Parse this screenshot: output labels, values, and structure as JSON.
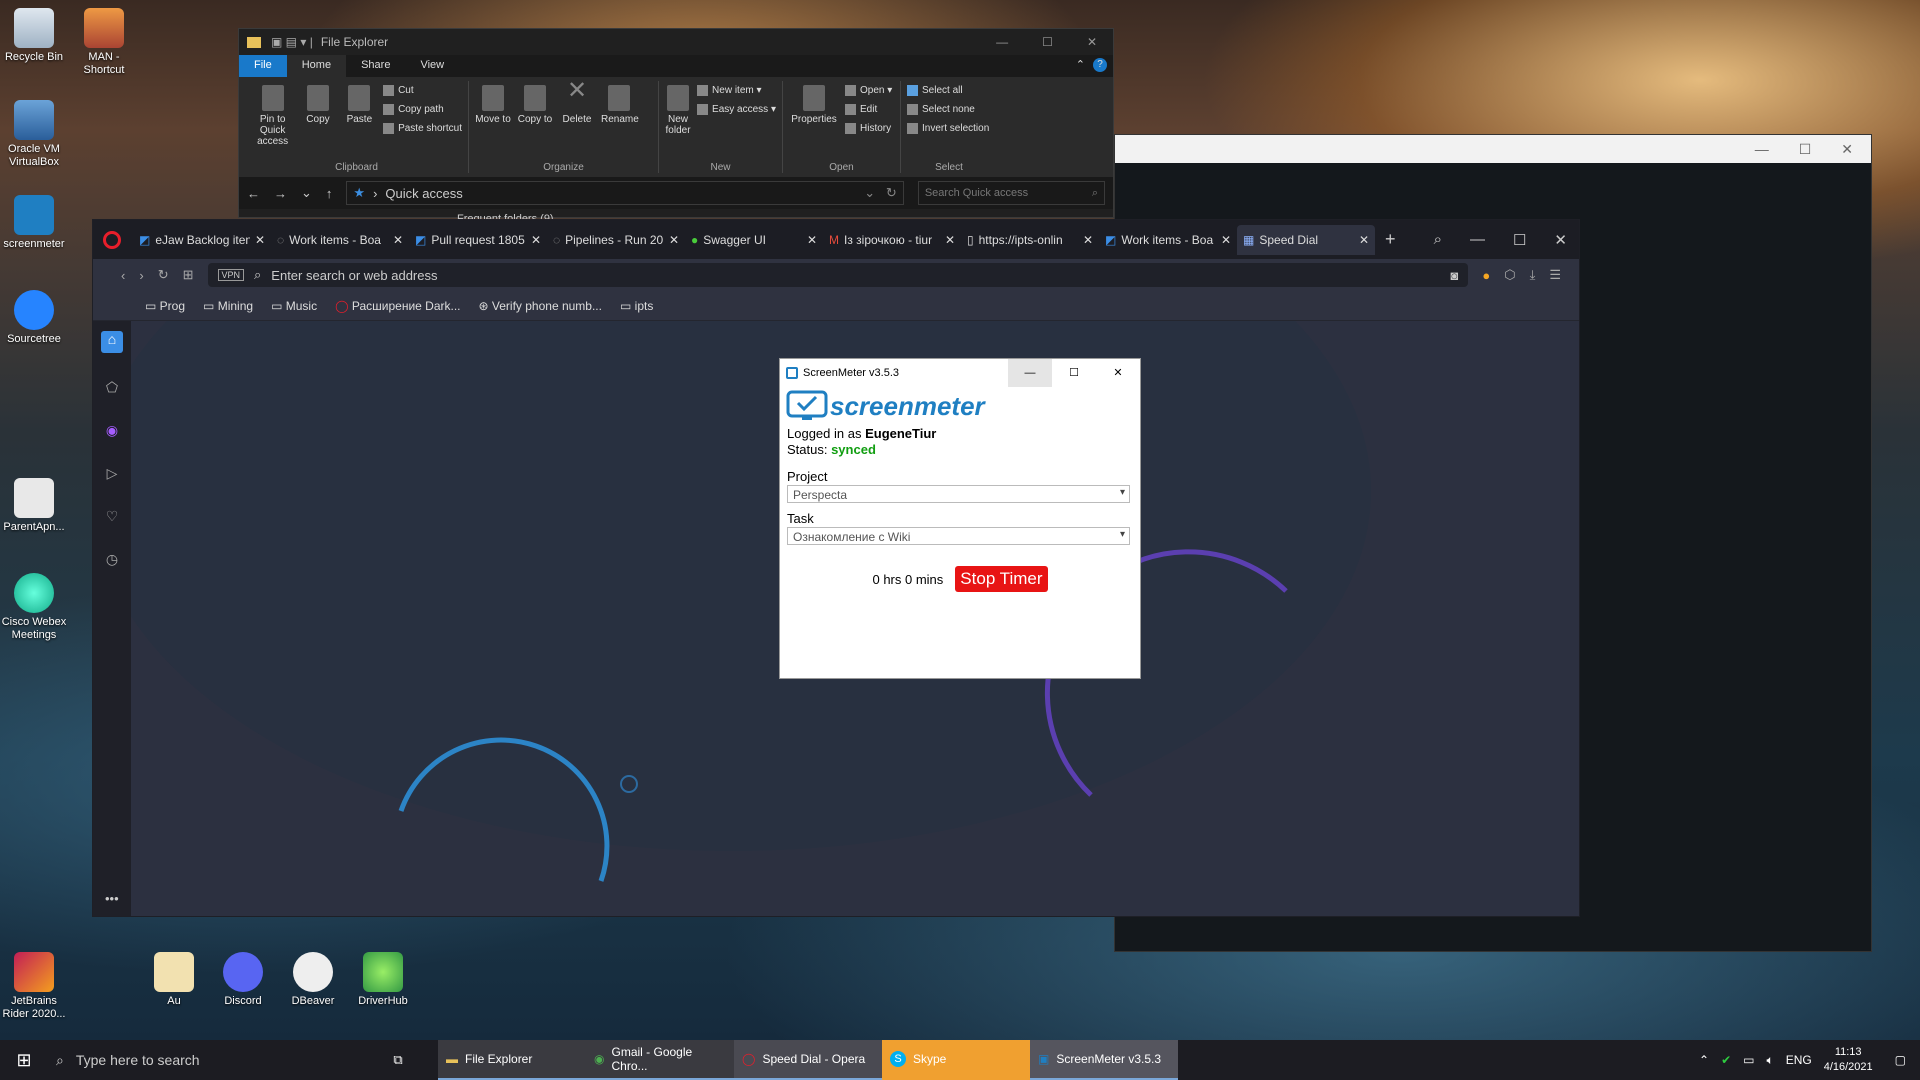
{
  "desktop": {
    "icons_left": [
      "Recycle Bin",
      "MAN - Shortcut",
      "Oracle VM VirtualBox",
      "screenmeter",
      "Sourcetree",
      "ParentApn...",
      "Cisco Webex Meetings",
      "JetBrains Rider 2020..."
    ],
    "icons_bottom": [
      "Au",
      "Discord",
      "DBeaver",
      "DriverHub"
    ]
  },
  "explorer": {
    "title": "File Explorer",
    "tabs": [
      "File",
      "Home",
      "Share",
      "View"
    ],
    "clipboard": {
      "pin": "Pin to Quick access",
      "copy": "Copy",
      "paste": "Paste",
      "cut": "Cut",
      "copy_path": "Copy path",
      "paste_shortcut": "Paste shortcut",
      "label": "Clipboard"
    },
    "organize": {
      "move": "Move to",
      "copy": "Copy to",
      "delete": "Delete",
      "rename": "Rename",
      "label": "Organize"
    },
    "new": {
      "folder": "New folder",
      "item": "New item",
      "easy": "Easy access",
      "label": "New"
    },
    "open": {
      "properties": "Properties",
      "open": "Open",
      "edit": "Edit",
      "history": "History",
      "label": "Open"
    },
    "select": {
      "all": "Select all",
      "none": "Select none",
      "invert": "Invert selection",
      "label": "Select"
    },
    "address": "Quick access",
    "search_placeholder": "Search Quick access",
    "frequent": "Frequent folders (9)"
  },
  "opera": {
    "tabs": [
      "eJaw Backlog iten",
      "Work items - Boa",
      "Pull request 1805",
      "Pipelines - Run 20",
      "Swagger UI",
      "Із зірочкою - tiur",
      "https://ipts-onlin",
      "Work items - Boa",
      "Speed Dial"
    ],
    "url_placeholder": "Enter search or web address",
    "vpn": "VPN",
    "bookmarks": [
      "Prog",
      "Mining",
      "Music",
      "Расширение Dark...",
      "Verify phone numb...",
      "ipts"
    ]
  },
  "screenmeter": {
    "title": "ScreenMeter v3.5.3",
    "logo": "screenmeter",
    "logged_prefix": "Logged in as ",
    "user": "EugeneTiur",
    "status_label": "Status: ",
    "status": "synced",
    "project_label": "Project",
    "project": "Perspecta",
    "task_label": "Task",
    "task": "Ознакомление с Wiki",
    "timer": "0 hrs 0 mins",
    "stop": "Stop Timer",
    "colors": {
      "stop": "#e81414",
      "synced": "#119e11",
      "logo": "#1f7fc2"
    }
  },
  "taskbar": {
    "search": "Type here to search",
    "apps": [
      "File Explorer",
      "Gmail - Google Chro...",
      "Speed Dial - Opera",
      "Skype",
      "ScreenMeter v3.5.3"
    ],
    "lang": "ENG",
    "time": "11:13",
    "date": "4/16/2021"
  }
}
